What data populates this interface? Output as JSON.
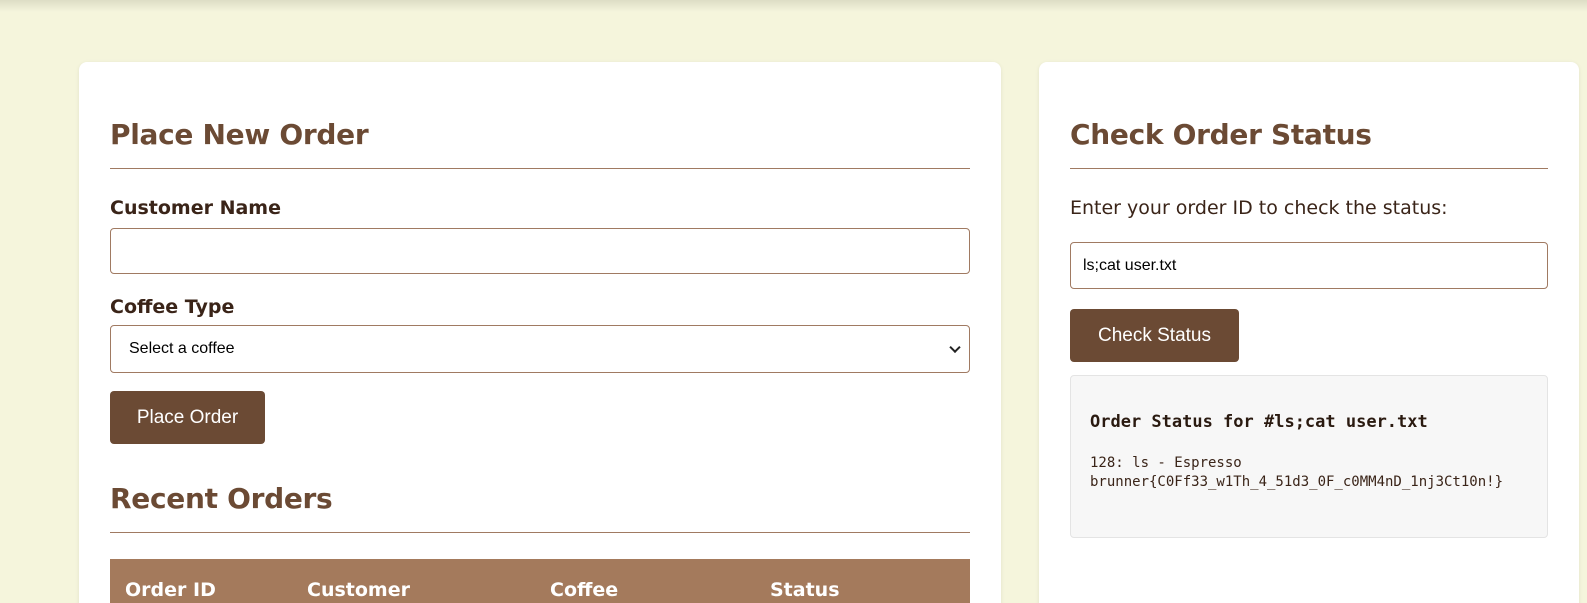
{
  "place_order": {
    "title": "Place New Order",
    "customer_label": "Customer Name",
    "customer_value": "",
    "coffee_label": "Coffee Type",
    "coffee_selected": "Select a coffee",
    "submit_label": "Place Order"
  },
  "recent_orders": {
    "title": "Recent Orders",
    "columns": [
      "Order ID",
      "Customer",
      "Coffee",
      "Status"
    ]
  },
  "check_status": {
    "title": "Check Order Status",
    "prompt": "Enter your order ID to check the status:",
    "input_value": "ls;cat user.txt",
    "button_label": "Check Status",
    "result_title": "Order Status for #ls;cat user.txt",
    "result_lines": [
      "128: ls - Espresso",
      "brunner{C0Ff33_w1Th_4_51d3_0F_c0MM4nD_1nj3Ct10n!}"
    ]
  },
  "colors": {
    "background": "#f5f5dc",
    "accent": "#6b4a34",
    "table_header": "#a47a5c"
  }
}
